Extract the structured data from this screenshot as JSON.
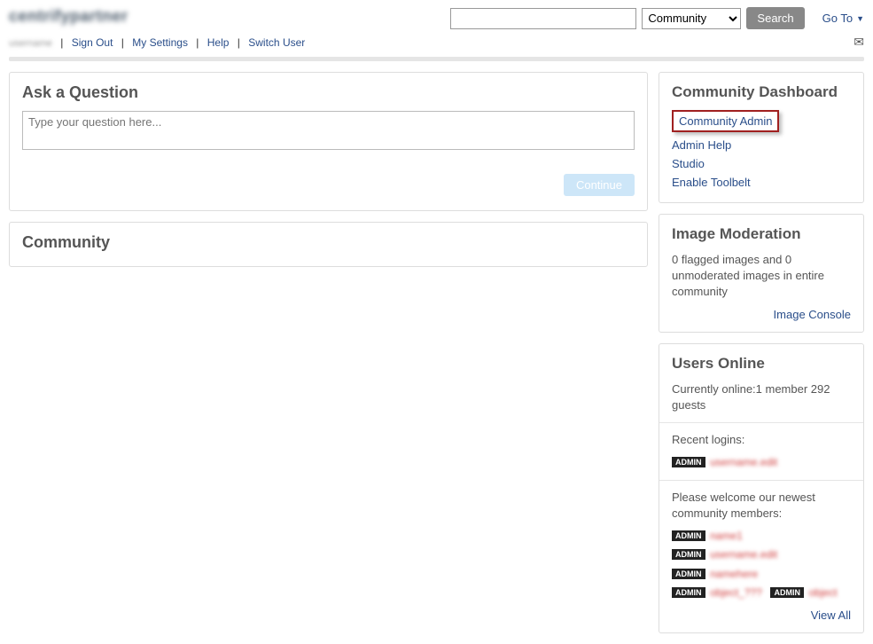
{
  "header": {
    "logo": "centrifypartner",
    "subtext": "username",
    "search_placeholder": "",
    "scope_selected": "Community",
    "search_btn": "Search",
    "goto": "Go To"
  },
  "nav": {
    "signout": "Sign Out",
    "mysettings": "My Settings",
    "help": "Help",
    "switchuser": "Switch User"
  },
  "ask": {
    "title": "Ask a Question",
    "placeholder": "Type your question here...",
    "continue": "Continue"
  },
  "community": {
    "title": "Community"
  },
  "dashboard": {
    "title": "Community Dashboard",
    "links": {
      "admin": "Community Admin",
      "help": "Admin Help",
      "studio": "Studio",
      "toolbelt": "Enable Toolbelt"
    }
  },
  "moderation": {
    "title": "Image Moderation",
    "text": "0 flagged images and 0 unmoderated images in entire community",
    "console": "Image Console"
  },
  "users": {
    "title": "Users Online",
    "currently": "Currently online:1 member 292 guests",
    "recent_label": "Recent logins:",
    "welcome_label": "Please welcome our newest community members:",
    "admin_badge": "ADMIN",
    "viewall": "View All",
    "names": {
      "r1": "username.edit",
      "w1": "name1",
      "w2": "username.edit",
      "w3": "namehere",
      "w4": "object_???",
      "w5": "object"
    }
  }
}
